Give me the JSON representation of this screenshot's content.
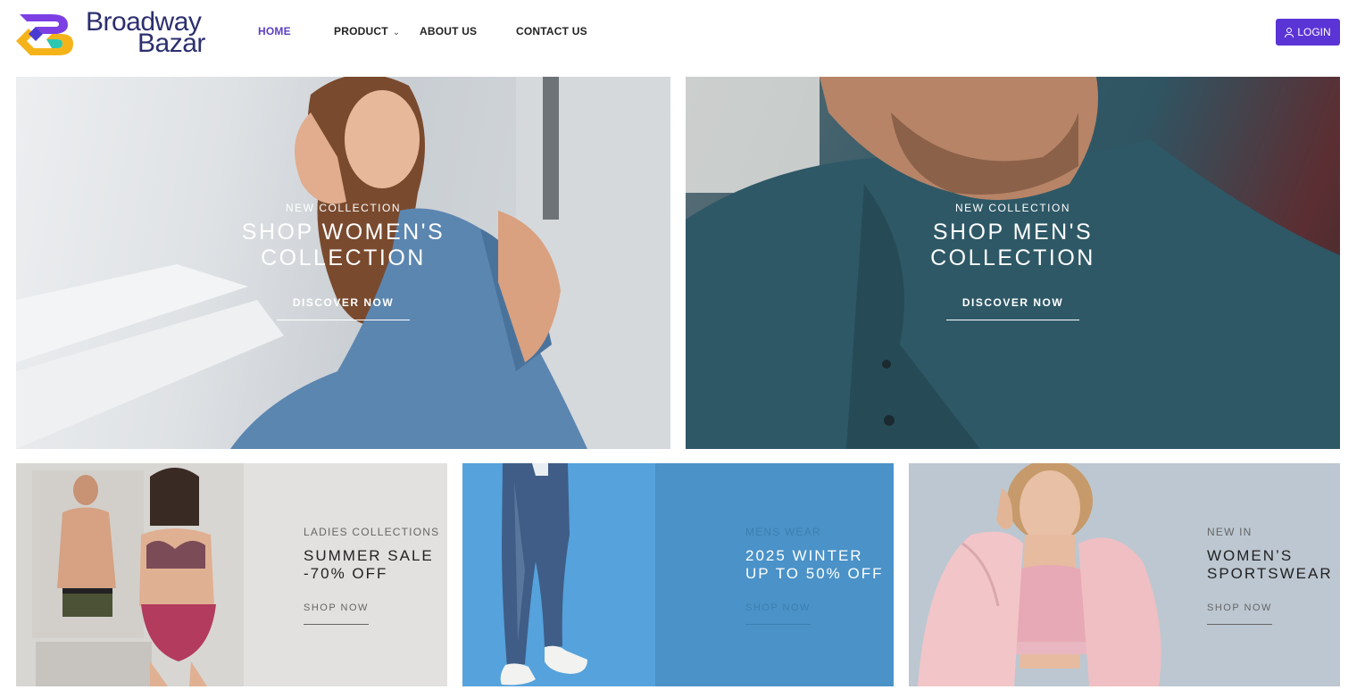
{
  "brand": {
    "name_line1": "Broadway",
    "name_line2": "Bazar",
    "colors": {
      "primary": "#5b34d6",
      "logo_purple": "#7b3fe4",
      "logo_yellow": "#f5b31a",
      "logo_teal": "#2cc7b0",
      "text_dark": "#2c2f6e"
    }
  },
  "nav": {
    "items": [
      {
        "label": "HOME",
        "active": true
      },
      {
        "label": "PRODUCT",
        "has_dropdown": true
      },
      {
        "label": "ABOUT US"
      },
      {
        "label": "CONTACT US"
      }
    ],
    "login_label": "LOGIN",
    "login_icon": "user-icon"
  },
  "heroes": [
    {
      "kicker": "NEW COLLECTION",
      "title_line1": "SHOP WOMEN'S",
      "title_line2": "COLLECTION",
      "cta": "DISCOVER NOW"
    },
    {
      "kicker": "NEW COLLECTION",
      "title_line1": "SHOP MEN'S",
      "title_line2": "COLLECTION",
      "cta": "DISCOVER NOW"
    }
  ],
  "tiles": [
    {
      "kicker": "LADIES COLLECTIONS",
      "title_line1": "SUMMER SALE",
      "title_line2": "-70% OFF",
      "cta": "SHOP NOW"
    },
    {
      "kicker": "MENS WEAR",
      "title_line1": "2025 WINTER",
      "title_line2": "UP TO 50% OFF",
      "cta": "SHOP NOW"
    },
    {
      "kicker": "NEW IN",
      "title_line1": "WOMEN’S",
      "title_line2": "SPORTSWEAR",
      "cta": "SHOP NOW"
    }
  ]
}
